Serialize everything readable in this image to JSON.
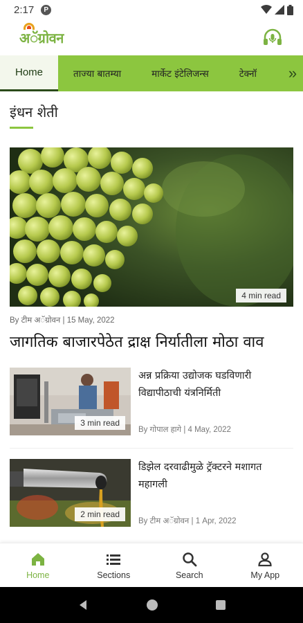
{
  "status_bar": {
    "time": "2:17",
    "app_icon": "P"
  },
  "header": {
    "logo_text": "अॅग्रोवन",
    "podcast_icon": "podcast-headphones-icon"
  },
  "nav_tabs": [
    {
      "label": "Home",
      "active": true
    },
    {
      "label": "ताज्या बातम्या",
      "active": false
    },
    {
      "label": "मार्केट इंटेलिजन्स",
      "active": false
    },
    {
      "label": "टेक्नॉ",
      "active": false
    }
  ],
  "section": {
    "title": "इंधन शेती"
  },
  "hero": {
    "read_time": "4 min read",
    "author_date": "By टीम अॅग्रोवन | 15 May, 2022",
    "title": "जागतिक बाजारपेठेत द्राक्ष निर्यातीला मोठा वाव"
  },
  "articles": [
    {
      "title": "अन्न प्रक्रिया उद्योजक घडविणारी विद्यापीठाची यंत्रनिर्मिती",
      "read_time": "3 min read",
      "meta": "By  गोपाल हागे  | 4 May, 2022"
    },
    {
      "title": "डिझेल दरवाढीमुळे ट्रॅक्टरने मशागत महागली",
      "read_time": "2 min read",
      "meta": "By टीम अॅग्रोवन | 1 Apr, 2022"
    }
  ],
  "bottom_nav": [
    {
      "label": "Home",
      "icon": "home-icon",
      "active": true
    },
    {
      "label": "Sections",
      "icon": "list-icon",
      "active": false
    },
    {
      "label": "Search",
      "icon": "search-icon",
      "active": false
    },
    {
      "label": "My App",
      "icon": "person-icon",
      "active": false
    }
  ],
  "colors": {
    "brand_green": "#8cc63f",
    "active_green": "#7cb342"
  }
}
